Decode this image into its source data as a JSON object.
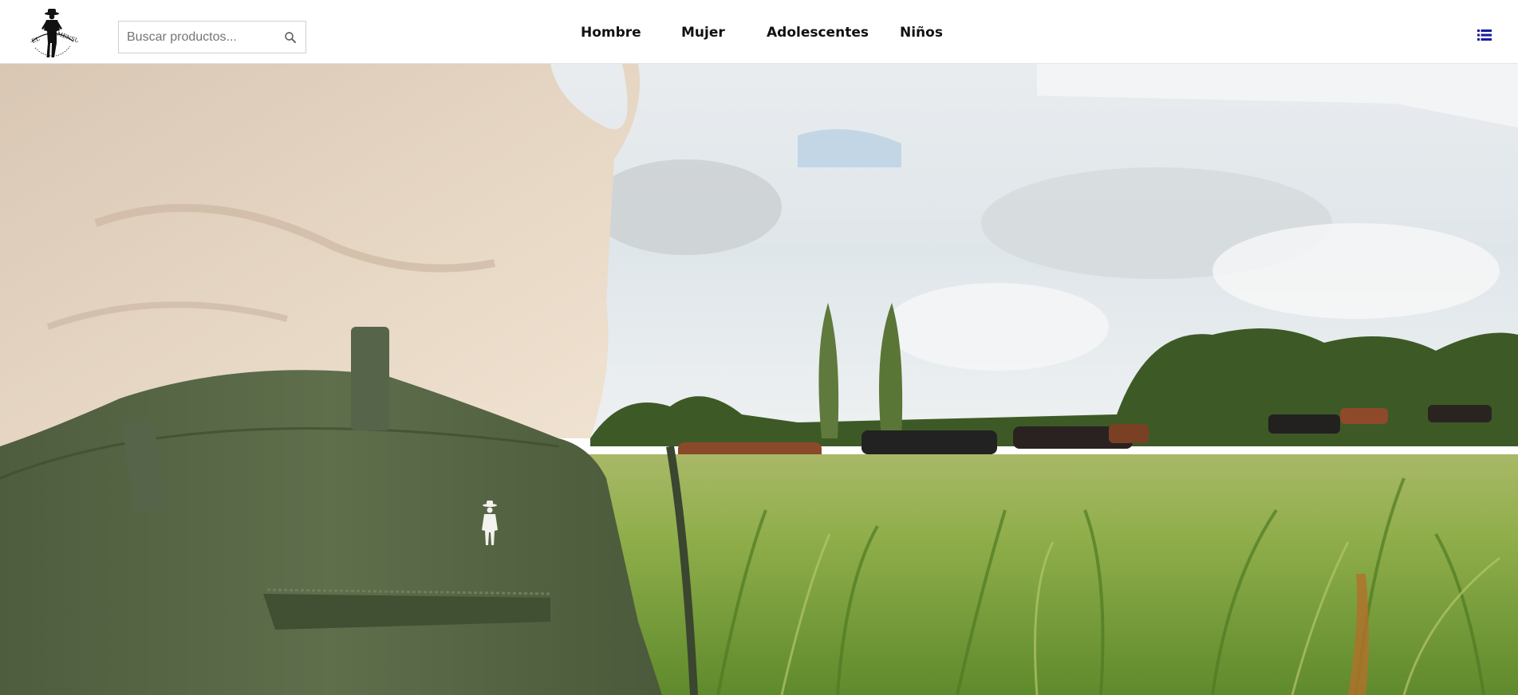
{
  "header": {
    "logo_alt": "El Mensual",
    "search": {
      "placeholder": "Buscar productos...",
      "value": ""
    },
    "nav": [
      {
        "label": "Hombre"
      },
      {
        "label": "Mujer"
      },
      {
        "label": "Adolescentes"
      },
      {
        "label": "Niños"
      }
    ],
    "menu_icon": "list-menu-icon"
  },
  "hero": {
    "description": ""
  },
  "colors": {
    "menu_icon": "#1a1aa0",
    "nav_text": "#111111"
  }
}
